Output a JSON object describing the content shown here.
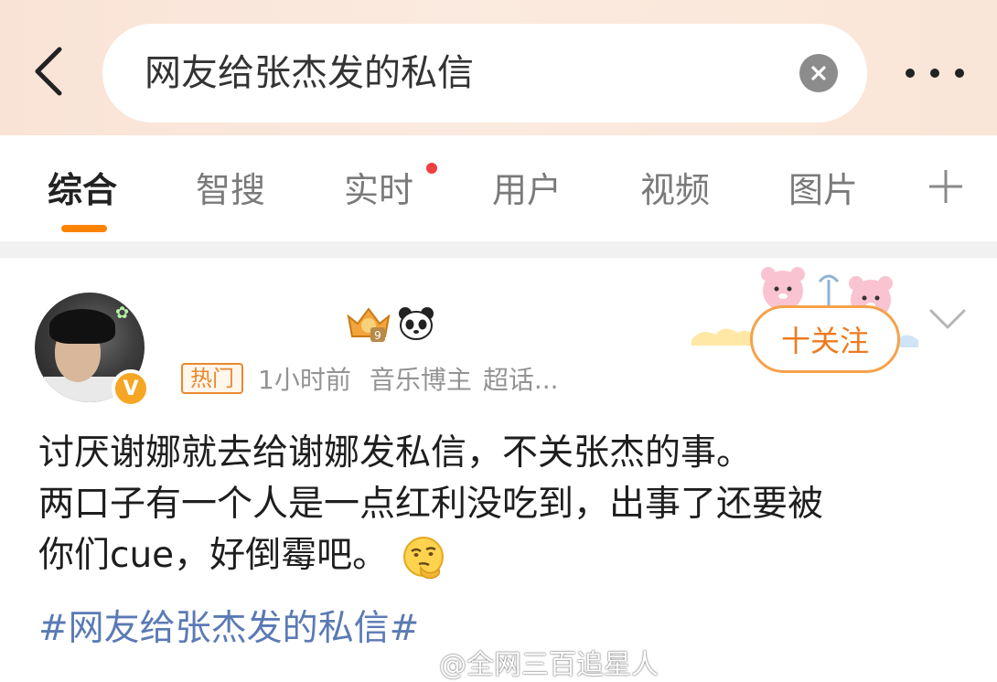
{
  "search": {
    "query": "网友给张杰发的私信"
  },
  "tabs": [
    {
      "label": "综合",
      "active": true
    },
    {
      "label": "智搜",
      "active": false
    },
    {
      "label": "实时",
      "active": false,
      "has_dot": true
    },
    {
      "label": "用户",
      "active": false
    },
    {
      "label": "视频",
      "active": false
    },
    {
      "label": "图片",
      "active": false
    }
  ],
  "post": {
    "tag": "热门",
    "time": "1小时前",
    "category": "音乐博主",
    "topic": "超话...",
    "follow_label": "十关注",
    "lines": [
      "讨厌谢娜就去给谢娜发私信，不关张杰的事。",
      "两口子有一个人是一点红利没吃到，出事了还要被",
      "你们cue，好倒霉吧。"
    ],
    "hashtag": "#网友给张杰发的私信#"
  },
  "watermark": "@全网三百追星人",
  "colors": {
    "accent": "#ff8200",
    "follow": "#ee7a1f",
    "hashtag": "#5b7ab5",
    "hot_tag": "#e8882f",
    "dot": "#f23f3f"
  }
}
